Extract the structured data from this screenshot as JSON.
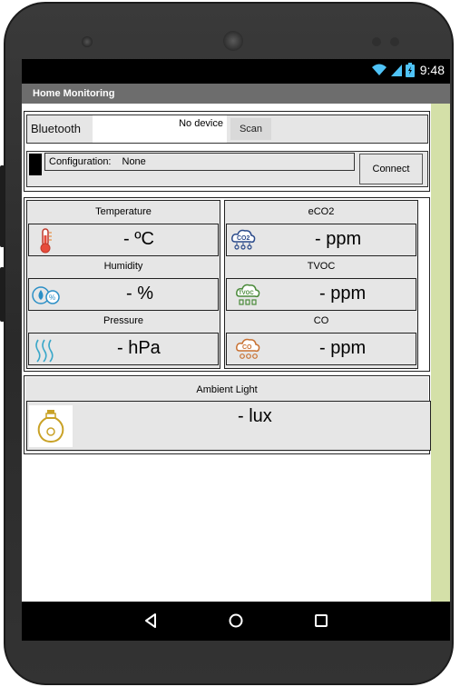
{
  "statusbar": {
    "time": "9:48",
    "icons": [
      "wifi-icon",
      "signal-icon",
      "battery-icon"
    ]
  },
  "app": {
    "title": "Home Monitoring"
  },
  "bluetooth": {
    "label": "Bluetooth",
    "device": "No device",
    "scan_label": "Scan"
  },
  "config": {
    "label": "Configuration:",
    "value": "None",
    "connect_label": "Connect"
  },
  "left_sensors": [
    {
      "title": "Temperature",
      "value": "- ºC",
      "icon": "thermometer-icon"
    },
    {
      "title": "Humidity",
      "value": "- %",
      "icon": "humidity-icon"
    },
    {
      "title": "Pressure",
      "value": "- hPa",
      "icon": "pressure-icon"
    }
  ],
  "right_sensors": [
    {
      "title": "eCO2",
      "value": "- ppm",
      "icon": "co2-cloud-icon",
      "icon_text": "CO2"
    },
    {
      "title": "TVOC",
      "value": "- ppm",
      "icon": "tvoc-cloud-icon",
      "icon_text": "TVOC"
    },
    {
      "title": "CO",
      "value": "- ppm",
      "icon": "co-cloud-icon",
      "icon_text": "CO"
    }
  ],
  "ambient": {
    "title": "Ambient Light",
    "value": "- lux",
    "icon": "light-bulb-icon"
  },
  "nav": {
    "icons": [
      "back-icon",
      "home-icon",
      "recents-icon"
    ]
  },
  "colors": {
    "accent_strip": "#d4e0a8",
    "titlebar": "#6d6d6d",
    "co2_icon": "#2a4a8a",
    "tvoc_icon": "#4a8a3a",
    "co_icon": "#c87030"
  }
}
